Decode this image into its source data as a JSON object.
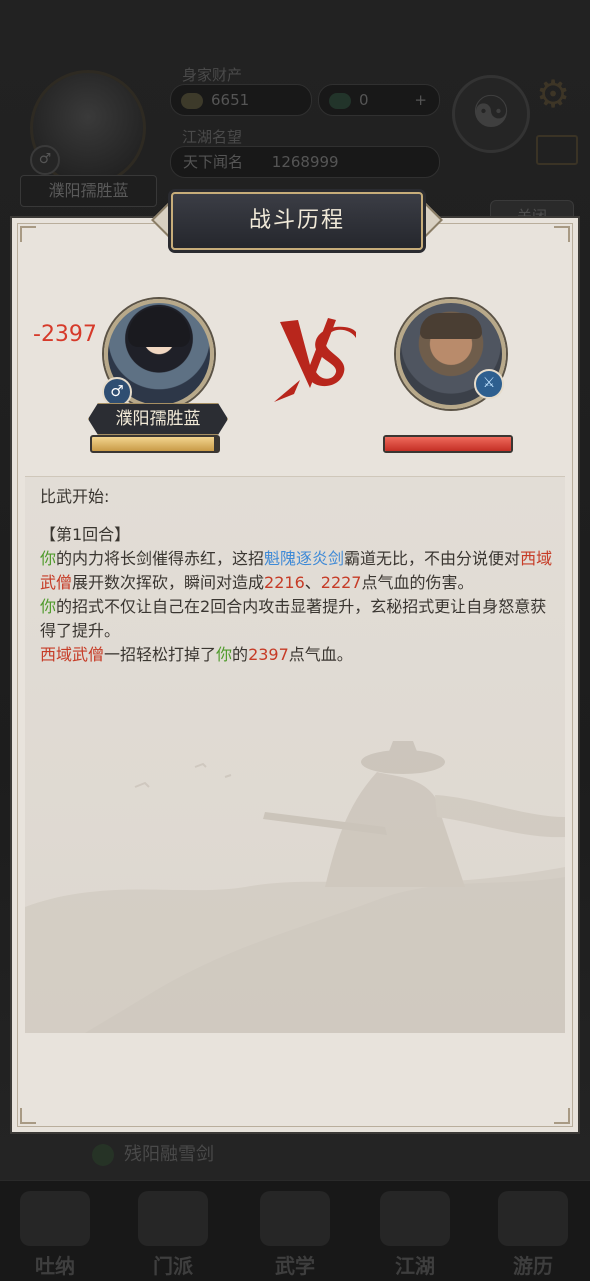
{
  "background": {
    "player_name": "濮阳孺胜蓝",
    "assets_label": "身家财产",
    "silver": "6651",
    "gems": "0",
    "add_symbol": "+",
    "reputation_label": "江湖名望",
    "rank_label": "天下闻名",
    "reputation_value": "1268999",
    "close_label": "关闭",
    "skill_name": "残阳融雪剑",
    "nav": [
      "吐纳",
      "门派",
      "武学",
      "江湖",
      "游历"
    ]
  },
  "modal": {
    "title": "战斗历程",
    "damage_popup": "-2397",
    "player": {
      "name": "濮阳孺胜蓝",
      "gender_symbol": "♂",
      "hp_ratio": 0.97
    },
    "enemy": {
      "name": "西域武僧",
      "class_symbol": "⚔",
      "hp_ratio": 1.0
    },
    "vs_label": "VS",
    "log": {
      "start": "比武开始:",
      "round_title": "【第1回合】",
      "e1": {
        "you": "你",
        "t1": "的内力将长剑催得赤红，这招",
        "skill": "魁隗逐炎剑",
        "t2": "霸道无比，不由分说便对",
        "enemy": "西域武僧",
        "t3": "展开数次挥砍，瞬间对造成",
        "dmg1": "2216",
        "sep": "、",
        "dmg2": "2227",
        "t4": "点气血的伤害。"
      },
      "e2": {
        "you": "你",
        "t1": "的招式不仅让自己在2回合内攻击显著提升，玄秘招式更让自身怒意获得了提升。"
      },
      "e3": {
        "enemy": "西域武僧",
        "t1": "一招轻松打掉了",
        "you": "你",
        "t2": "的",
        "dmg": "2397",
        "t3": "点气血。"
      }
    }
  },
  "colors": {
    "self": "#4f9b2c",
    "skill": "#3f8ad6",
    "enemy_and_damage": "#c63b26",
    "panel": "#e8e3dc",
    "title_plate": "#2b2d33"
  }
}
